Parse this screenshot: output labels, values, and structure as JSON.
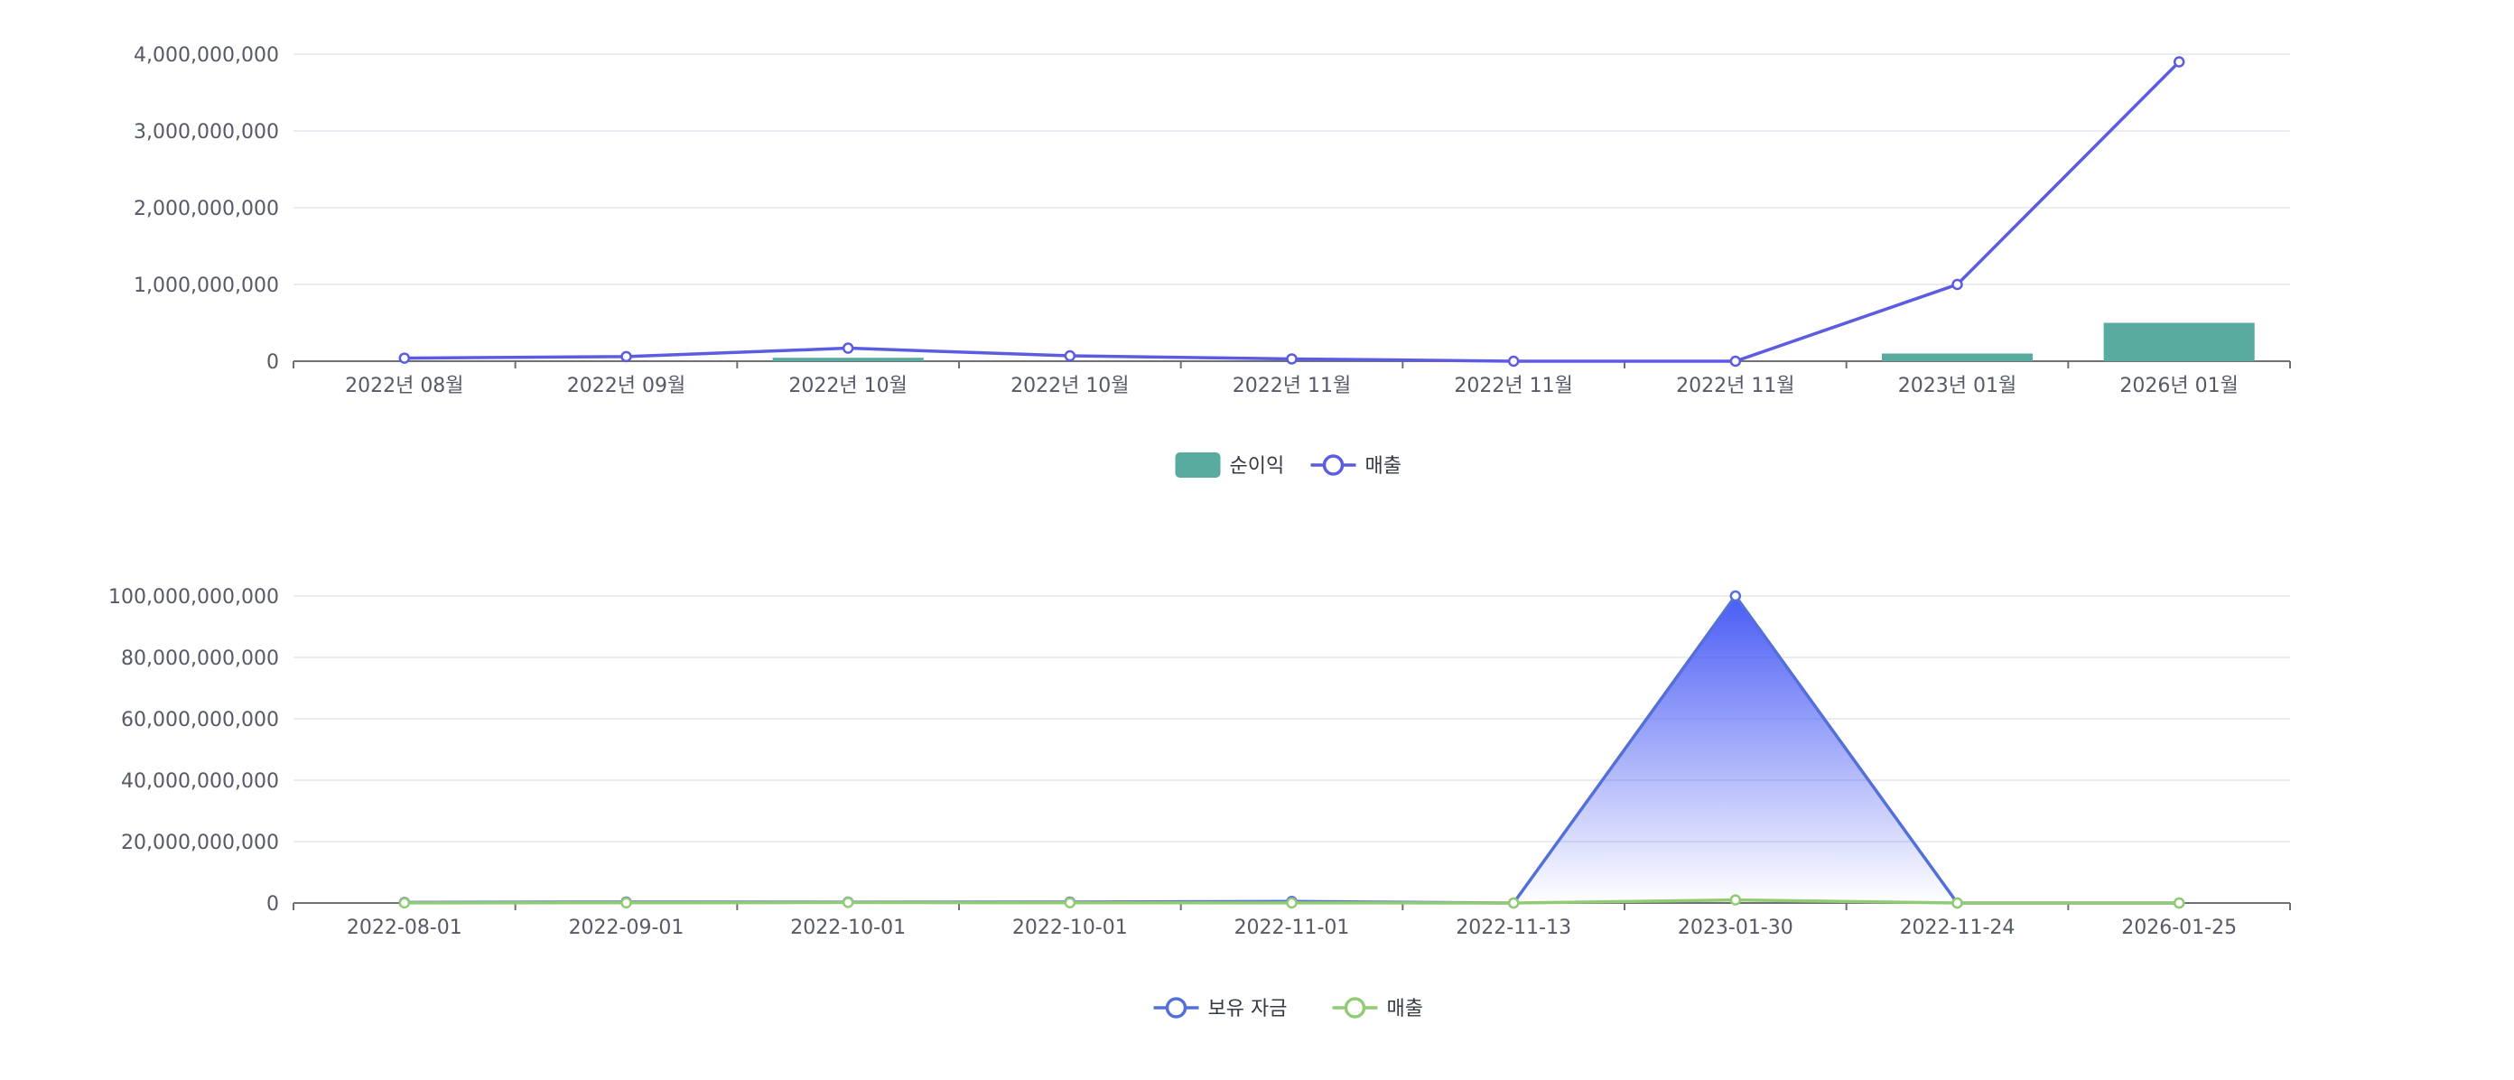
{
  "chart_data": [
    {
      "type": "bar",
      "categories": [
        "2022년 08월",
        "2022년 09월",
        "2022년 10월",
        "2022년 10월",
        "2022년 11월",
        "2022년 11월",
        "2022년 11월",
        "2023년 01월",
        "2026년 01월"
      ],
      "ylim": [
        0,
        4000000000
      ],
      "yticks": [
        0,
        1000000000,
        2000000000,
        3000000000,
        4000000000
      ],
      "ytick_labels": [
        "0",
        "1,000,000,000",
        "2,000,000,000",
        "3,000,000,000",
        "4,000,000,000"
      ],
      "grid": true,
      "legend_placement": "bottom-center",
      "series": [
        {
          "name": "순이익",
          "kind": "bar",
          "color": "#5aab9f",
          "values": [
            0,
            0,
            45000000,
            0,
            0,
            0,
            0,
            100000000,
            500000000
          ]
        },
        {
          "name": "매출",
          "kind": "line",
          "color": "#5b5ce2",
          "values": [
            40000000,
            60000000,
            170000000,
            70000000,
            30000000,
            0,
            0,
            1000000000,
            3900000000
          ]
        }
      ]
    },
    {
      "type": "area",
      "categories": [
        "2022-08-01",
        "2022-09-01",
        "2022-10-01",
        "2022-10-01",
        "2022-11-01",
        "2022-11-13",
        "2023-01-30",
        "2022-11-24",
        "2026-01-25"
      ],
      "ylim": [
        0,
        100000000000
      ],
      "yticks": [
        0,
        20000000000,
        40000000000,
        60000000000,
        80000000000,
        100000000000
      ],
      "ytick_labels": [
        "0",
        "20,000,000,000",
        "40,000,000,000",
        "60,000,000,000",
        "80,000,000,000",
        "100,000,000,000"
      ],
      "grid": true,
      "legend_placement": "bottom-center",
      "series": [
        {
          "name": "보유 자금",
          "kind": "area",
          "color": "#5470d8",
          "fill_color": "#4a5cf5",
          "values": [
            200000000,
            300000000,
            300000000,
            300000000,
            500000000,
            0,
            100000000000,
            0,
            0
          ]
        },
        {
          "name": "매출",
          "kind": "line",
          "color": "#91cc75",
          "values": [
            40000000,
            60000000,
            170000000,
            70000000,
            30000000,
            0,
            1000000000,
            0,
            0
          ]
        }
      ]
    }
  ]
}
